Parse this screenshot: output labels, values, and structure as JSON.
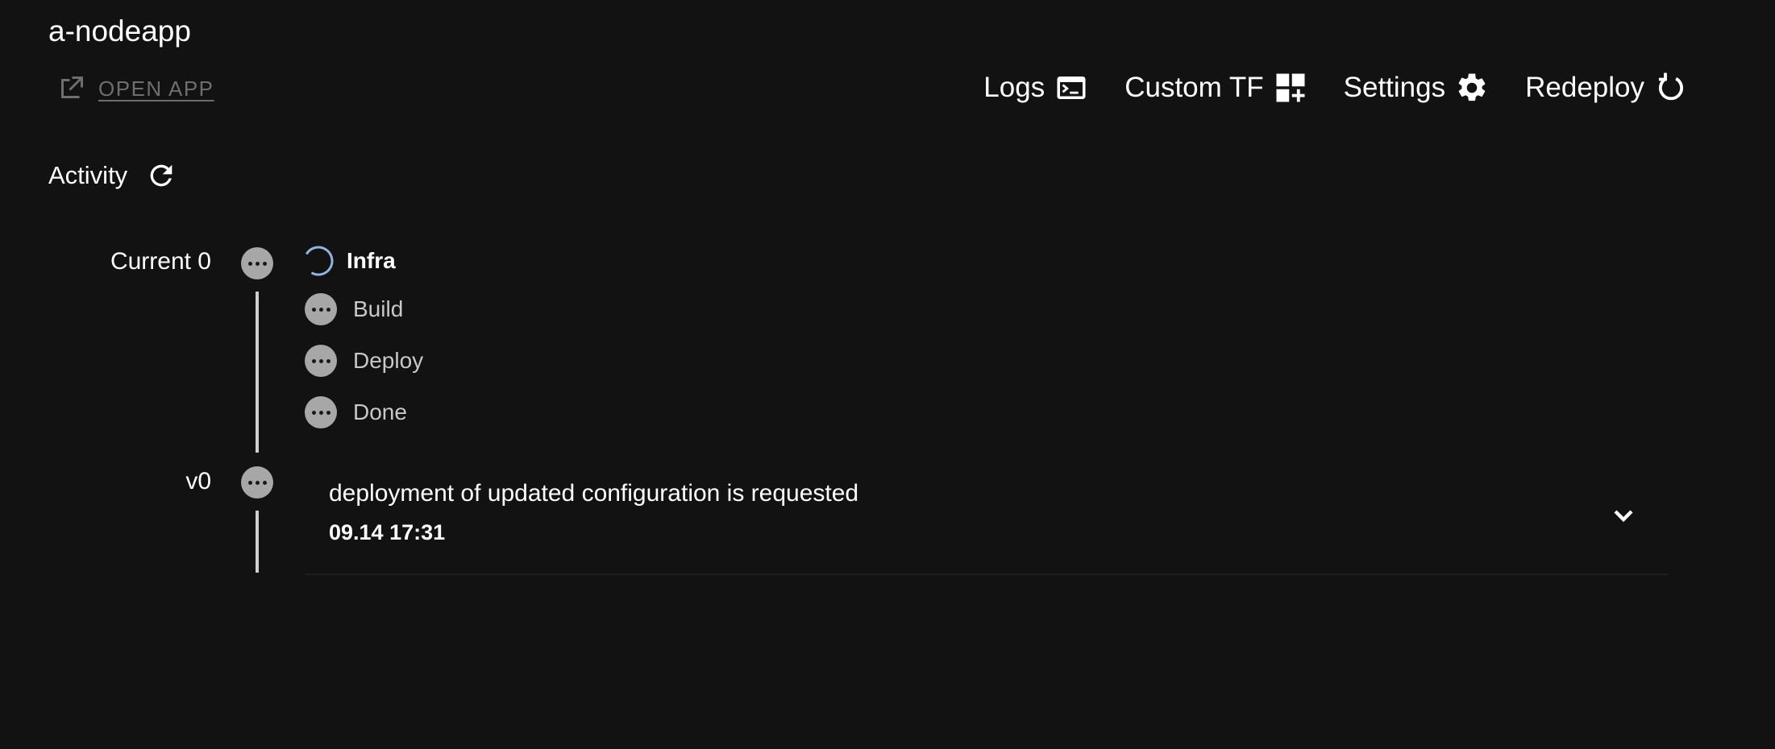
{
  "app": {
    "title": "a-nodeapp"
  },
  "open_app": {
    "label": "OPEN APP",
    "icon": "external-link-icon"
  },
  "toolbar": {
    "logs_label": "Logs",
    "custom_tf_label": "Custom TF",
    "settings_label": "Settings",
    "redeploy_label": "Redeploy"
  },
  "activity": {
    "title": "Activity",
    "icon": "refresh-icon"
  },
  "timeline": {
    "current_label": "Current 0",
    "steps": [
      {
        "label": "Infra",
        "status": "in-progress"
      },
      {
        "label": "Build",
        "status": "pending"
      },
      {
        "label": "Deploy",
        "status": "pending"
      },
      {
        "label": "Done",
        "status": "pending"
      }
    ],
    "version_label": "v0",
    "event": {
      "message": "deployment of updated configuration is requested",
      "time": "09.14 17:31"
    }
  },
  "colors": {
    "background": "#121212",
    "text": "#ffffff",
    "muted": "#6e6e6e",
    "dot": "#a7a7a7",
    "spinner": "#90b4e0"
  }
}
